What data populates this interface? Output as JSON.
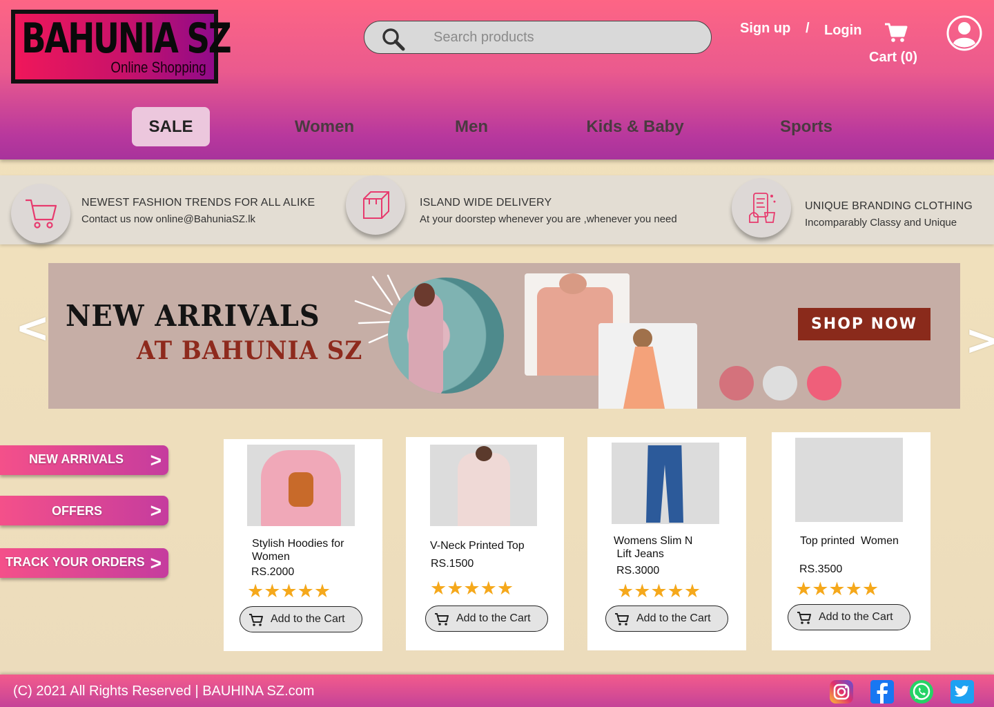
{
  "brand": {
    "name": "BAHUNIA SZ",
    "tagline": "Online Shopping"
  },
  "search": {
    "placeholder": "Search products"
  },
  "auth": {
    "signup": "Sign up",
    "separator": "/",
    "login": "Login"
  },
  "cart": {
    "label": "Cart (0)"
  },
  "nav": [
    "SALE",
    "Women",
    "Men",
    "Kids & Baby",
    "Sports"
  ],
  "info": [
    {
      "icon": "cart-icon",
      "title": "NEWEST FASHION TRENDS FOR ALL ALIKE",
      "text": "Contact us now online@BahuniaSZ.lk"
    },
    {
      "icon": "box-icon",
      "title": "ISLAND WIDE DELIVERY",
      "text": "At your doorstep whenever you are ,whenever you need"
    },
    {
      "icon": "branding-icon",
      "title": "UNIQUE BRANDING CLOTHING",
      "text": "Incomparably Classy and Unique"
    }
  ],
  "banner": {
    "title": "NEW ARRIVALS",
    "subtitle": "AT BAHUNIA SZ",
    "cta": "SHOP NOW",
    "prev": "<",
    "next": ">",
    "dots": [
      "#d4727c",
      "#dedede",
      "#ef5f7a"
    ]
  },
  "side_menu": [
    {
      "label": "NEW ARRIVALS",
      "chevron": ">"
    },
    {
      "label": "OFFERS",
      "chevron": ">"
    },
    {
      "label": "TRACK YOUR ORDERS",
      "chevron": ">"
    }
  ],
  "products": [
    {
      "name": "Stylish Hoodies for\nWomen",
      "price": "RS.2000",
      "rating": 5,
      "stars": "★★★★★",
      "button": "Add to the Cart"
    },
    {
      "name": "V-Neck Printed Top",
      "price": "RS.1500",
      "rating": 5,
      "stars": "★★★★★",
      "button": "Add to the Cart"
    },
    {
      "name": "Womens Slim N\n Lift Jeans",
      "price": "RS.3000",
      "rating": 5,
      "stars": "★★★★★",
      "button": "Add to the Cart"
    },
    {
      "name": "Top printed  Women",
      "price": "RS.3500",
      "rating": 5,
      "stars": "★★★★★",
      "button": "Add to the Cart"
    }
  ],
  "footer": {
    "text": "(C) 2021 All Rights Reserved  | BAUHINA SZ.com",
    "social": [
      "instagram-icon",
      "facebook-icon",
      "whatsapp-icon",
      "twitter-icon"
    ]
  },
  "colors": {
    "accent": "#ea5a8e",
    "header_bottom": "#a8339c",
    "star": "#f5a81b",
    "cta": "#8a2a1b"
  }
}
